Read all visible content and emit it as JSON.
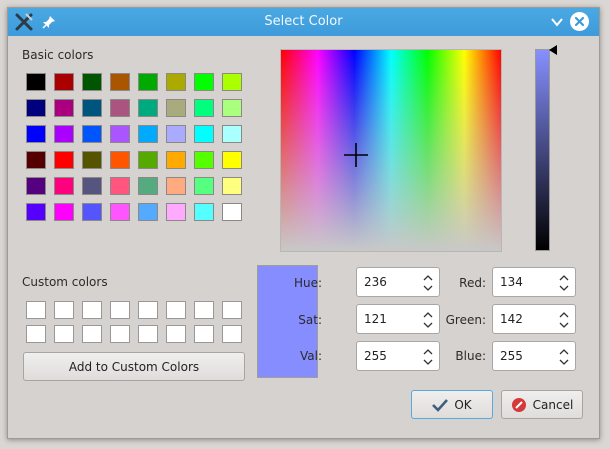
{
  "window": {
    "title": "Select Color"
  },
  "labels": {
    "basic_colors": "Basic colors",
    "custom_colors": "Custom colors"
  },
  "buttons": {
    "add_custom": "Add to Custom Colors",
    "ok": "OK",
    "cancel": "Cancel"
  },
  "basic_colors": [
    "#000000",
    "#aa0000",
    "#005500",
    "#aa5500",
    "#00aa00",
    "#aaaa00",
    "#00ff00",
    "#aaff00",
    "#00007f",
    "#aa007f",
    "#00557f",
    "#aa557f",
    "#00aa7f",
    "#aaaa7f",
    "#00ff7f",
    "#aaff7f",
    "#0000ff",
    "#aa00ff",
    "#0055ff",
    "#aa55ff",
    "#00aaff",
    "#aaaaff",
    "#00ffff",
    "#aaffff",
    "#550000",
    "#ff0000",
    "#555500",
    "#ff5500",
    "#55aa00",
    "#ffaa00",
    "#55ff00",
    "#ffff00",
    "#55007f",
    "#ff007f",
    "#55557f",
    "#ff557f",
    "#55aa7f",
    "#ffaa7f",
    "#55ff7f",
    "#ffff7f",
    "#5500ff",
    "#ff00ff",
    "#5555ff",
    "#ff55ff",
    "#55aaff",
    "#ffaaff",
    "#55ffff",
    "#ffffff"
  ],
  "custom_colors": [
    "#ffffff",
    "#ffffff",
    "#ffffff",
    "#ffffff",
    "#ffffff",
    "#ffffff",
    "#ffffff",
    "#ffffff",
    "#ffffff",
    "#ffffff",
    "#ffffff",
    "#ffffff",
    "#ffffff",
    "#ffffff",
    "#ffffff",
    "#ffffff"
  ],
  "current_color": "#868eff",
  "fields": {
    "hue": {
      "label": "Hue:",
      "value": "236"
    },
    "sat": {
      "label": "Sat:",
      "value": "121"
    },
    "val": {
      "label": "Val:",
      "value": "255"
    },
    "red": {
      "label": "Red:",
      "value": "134"
    },
    "green": {
      "label": "Green:",
      "value": "142"
    },
    "blue": {
      "label": "Blue:",
      "value": "255"
    }
  },
  "icons": {
    "app": "tools-icon",
    "pin": "pin-icon",
    "minimize": "chevron-down-icon",
    "close": "close-icon",
    "ok": "checkmark-icon",
    "cancel": "no-entry-icon"
  },
  "theme": {
    "titlebar": "#3d9bdb",
    "background": "#d6d2d0",
    "focus": "#58a9de"
  }
}
